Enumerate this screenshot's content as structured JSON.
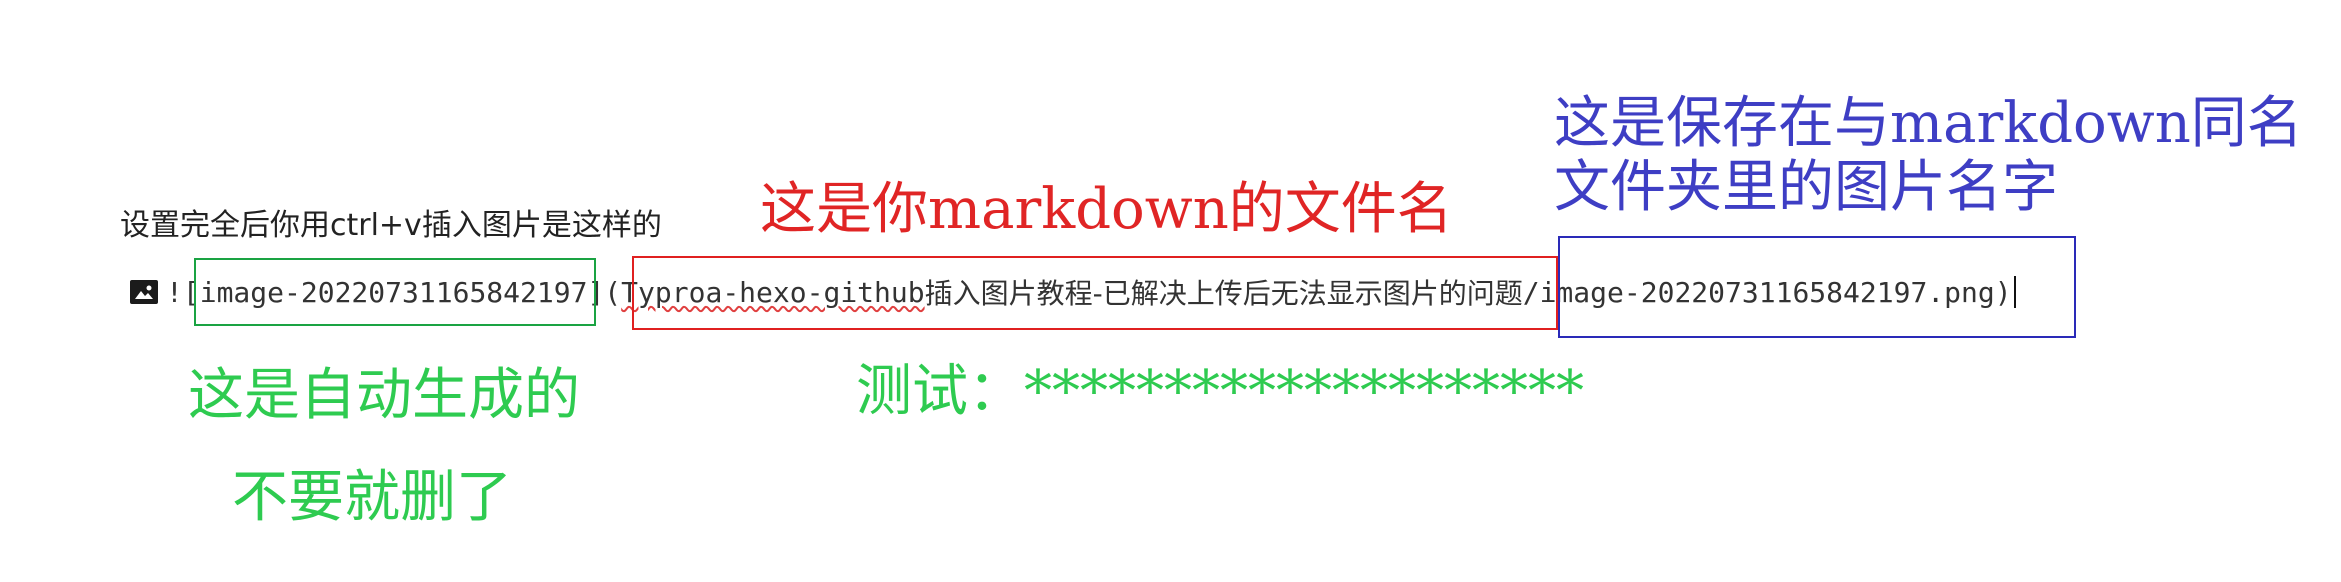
{
  "intro_text": "设置完全后你用ctrl+v插入图片是这样的",
  "markdown_line": {
    "prefix": "![",
    "alt_text": "image-20220731165842197",
    "mid": "](",
    "folder_latin": "Typroa-hexo-github",
    "folder_cjk": "插入图片教程-已解决上传后无法显示图片的问题",
    "slash": "/",
    "filename": "image-20220731165842197.png",
    "suffix": ")"
  },
  "annotations": {
    "red": "这是你markdown的文件名",
    "blue_line1": "这是保存在与markdown同名",
    "blue_line2": "文件夹里的图片名字",
    "green_line1": "这是自动生成的",
    "green_line2": "不要就删了",
    "test_label": "测试：",
    "test_value": "********************"
  },
  "colors": {
    "red": "#e02020",
    "blue": "#2a2ab8",
    "green": "#1aa343",
    "text": "#222222"
  },
  "icons": [
    "image-icon"
  ]
}
